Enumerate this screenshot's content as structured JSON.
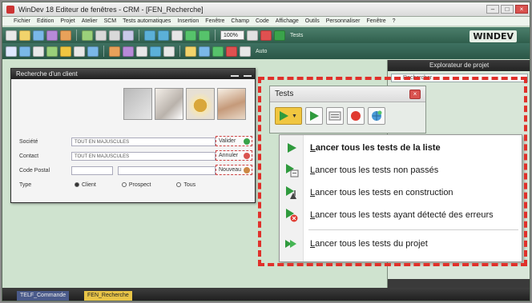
{
  "window": {
    "title": "WinDev 18  Editeur de fenêtres - CRM - [FEN_Recherche]",
    "controls": [
      "–",
      "□",
      "×"
    ]
  },
  "menubar": [
    "Fichier",
    "Edition",
    "Projet",
    "Atelier",
    "SCM",
    "Tests automatiques",
    "Insertion",
    "Fenêtre",
    "Champ",
    "Code",
    "Affichage",
    "Outils",
    "Personnaliser",
    "Fenêtre",
    "?"
  ],
  "toolbar": {
    "zoom": "100%",
    "tests_label": "Tests",
    "auto_label": "Auto",
    "brand": "WINDEV"
  },
  "project_pane": {
    "title": "Explorateur de projet",
    "search_placeholder": "Rechercher"
  },
  "bottom_tabs": [
    "TELF_Commande",
    "FEN_Recherche"
  ],
  "designer": {
    "title": "Recherche d'un client",
    "fields": [
      {
        "label": "Société",
        "value": "TOUT EN MAJUSCULES"
      },
      {
        "label": "Contact",
        "value": "TOUT EN MAJUSCULES"
      },
      {
        "label": "Code Postal",
        "value": ""
      }
    ],
    "type_label": "Type",
    "radios": [
      "Client",
      "Prospect",
      "Tous"
    ],
    "buttons": [
      {
        "label": "Valider",
        "color": "#3aa34a"
      },
      {
        "label": "Annuler",
        "color": "#d9534f"
      },
      {
        "label": "Nouveau",
        "color": "#cc8844"
      }
    ]
  },
  "tests_panel": {
    "title": "Tests",
    "close": "×"
  },
  "menu": {
    "items": [
      {
        "label": "Lancer tous les tests de la liste",
        "icon": "run-all-icon",
        "bold": true
      },
      {
        "label": "Lancer tous les tests non passés",
        "icon": "run-not-passed-icon",
        "bold": false
      },
      {
        "label": "Lancer tous les tests en construction",
        "icon": "run-in-construction-icon",
        "bold": false
      },
      {
        "label": "Lancer tous les tests ayant détecté des erreurs",
        "icon": "run-failed-icon",
        "bold": false
      },
      {
        "label": "Lancer tous les tests du projet",
        "icon": "run-project-icon",
        "bold": false
      }
    ]
  },
  "colors": {
    "highlight": "#e0302a",
    "active_tool": "#f0c640",
    "play_green": "#3aa34a"
  }
}
